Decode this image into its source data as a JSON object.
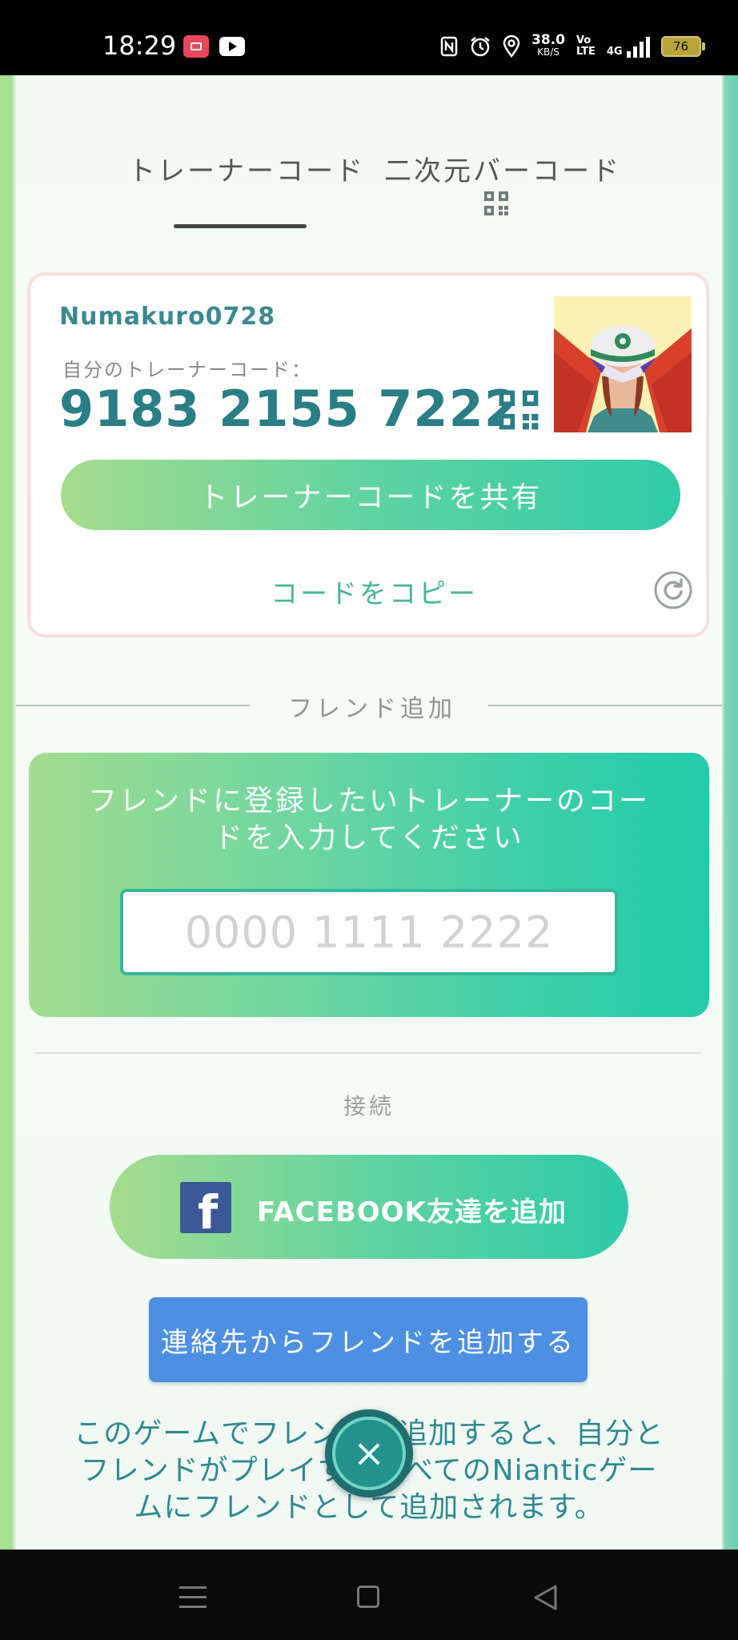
{
  "status_bar": {
    "time": "18:29",
    "speed_value": "38.0",
    "speed_unit": "KB/S",
    "volte_top": "Vo",
    "volte_bottom": "LTE",
    "network": "4G",
    "battery": "76",
    "icons": [
      "screen-record-icon",
      "youtube-icon",
      "nfc-icon",
      "alarm-icon",
      "location-icon",
      "signal-icon",
      "battery-icon"
    ]
  },
  "tabs": {
    "trainer_code": "トレーナーコード",
    "qr_code": "二次元バーコード"
  },
  "profile": {
    "username": "Numakuro0728",
    "code_caption": "自分のトレーナーコード：",
    "trainer_code": "9183 2155 7222",
    "share_button": "トレーナーコードを共有",
    "copy_link": "コードをコピー"
  },
  "friend_add": {
    "heading": "フレンド追加",
    "instruction": "フレンドに登録したいトレーナーのコードを入力してください",
    "input_placeholder": "0000 1111 2222",
    "input_value": ""
  },
  "connect": {
    "heading": "接続",
    "facebook_logo_letter": "f",
    "facebook_button": "FACEBOOK友達を追加",
    "contacts_button": "連絡先からフレンドを追加する"
  },
  "bottom_note": "このゲームでフレンドを追加すると、自分とフレンドがプレイするすべてのNianticゲームにフレンドとして追加されます。",
  "close_button": "×",
  "colors": {
    "teal_text": "#2a7e86",
    "accent_green": "#48b59a",
    "facebook_blue": "#3b5998",
    "contacts_blue": "#4d8fe3"
  }
}
